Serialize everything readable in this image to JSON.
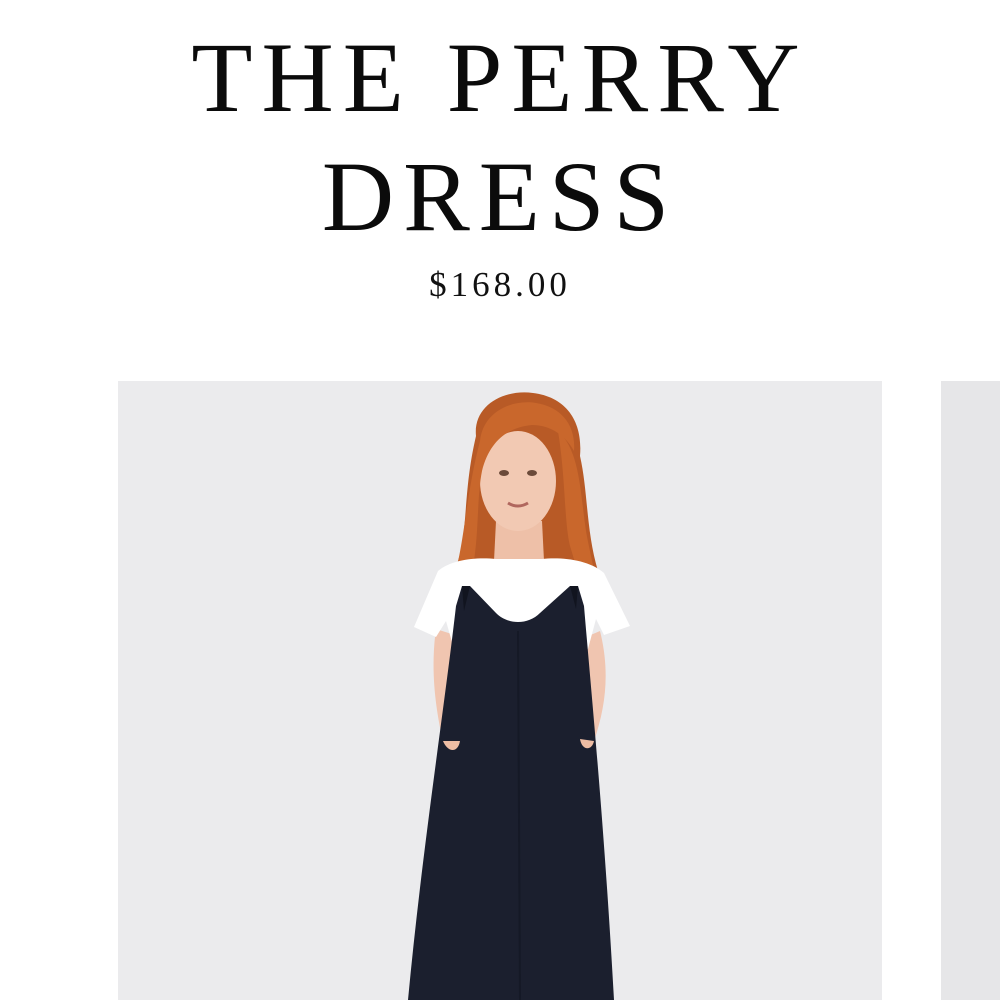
{
  "product": {
    "title_line1": "THE PERRY",
    "title_line2": "DRESS",
    "price": "$168.00"
  },
  "gallery": {
    "images": [
      {
        "subject": "model-wearing-navy-slip-dress-over-white-tee"
      },
      {
        "subject": "next-image-partially-visible"
      }
    ]
  },
  "colors": {
    "text": "#0b0b0b",
    "image_background": "#ebebed",
    "dress": "#1b1f2e",
    "hair": "#c4652c"
  }
}
